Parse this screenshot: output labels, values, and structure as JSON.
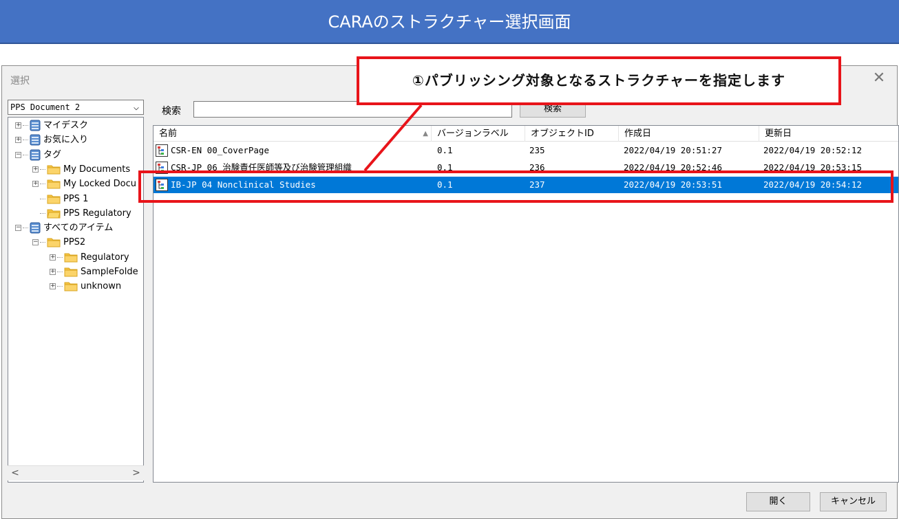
{
  "banner": {
    "title": "CARAのストラクチャー選択画面"
  },
  "dialog": {
    "title": "選択",
    "close_glyph": "✕",
    "repository": {
      "selected": "PPS Document 2",
      "arrow": "⌵"
    },
    "tree": {
      "nodes": [
        {
          "label": "マイデスク",
          "icon": "database-icon",
          "expander": "+"
        },
        {
          "label": "お気に入り",
          "icon": "database-icon",
          "expander": "+"
        },
        {
          "label": "タグ",
          "icon": "database-icon",
          "expander": "−"
        },
        {
          "label": "My Documents",
          "icon": "folder-icon",
          "expander": "+"
        },
        {
          "label": "My Locked Docu",
          "icon": "folder-icon",
          "expander": "+"
        },
        {
          "label": "PPS 1",
          "icon": "folder-icon",
          "expander": ""
        },
        {
          "label": "PPS Regulatory",
          "icon": "folder-open-icon",
          "expander": ""
        },
        {
          "label": "すべてのアイテム",
          "icon": "database-icon",
          "expander": "−"
        },
        {
          "label": "PPS2",
          "icon": "folder-icon",
          "expander": "−"
        },
        {
          "label": "Regulatory",
          "icon": "folder-icon",
          "expander": "+"
        },
        {
          "label": "SampleFolde",
          "icon": "folder-icon",
          "expander": "+"
        },
        {
          "label": "unknown",
          "icon": "folder-icon",
          "expander": "+"
        }
      ],
      "scroll_left": "<",
      "scroll_right": ">"
    },
    "search": {
      "label": "検索",
      "value": "",
      "button": "検索"
    },
    "table": {
      "columns": [
        "名前",
        "バージョンラベル",
        "オブジェクトID",
        "作成日",
        "更新日"
      ],
      "sort_glyph": "▲",
      "rows": [
        {
          "name": "CSR-EN 00_CoverPage",
          "version": "0.1",
          "object_id": "235",
          "created": "2022/04/19 20:51:27",
          "updated": "2022/04/19 20:52:12",
          "selected": false
        },
        {
          "name": "CSR-JP 06 治験責任医師等及び治験管理組織",
          "version": "0.1",
          "object_id": "236",
          "created": "2022/04/19 20:52:46",
          "updated": "2022/04/19 20:53:15",
          "selected": false
        },
        {
          "name": "IB-JP 04 Nonclinical Studies",
          "version": "0.1",
          "object_id": "237",
          "created": "2022/04/19 20:53:51",
          "updated": "2022/04/19 20:54:12",
          "selected": true
        }
      ]
    },
    "buttons": {
      "open": "開く",
      "cancel": "キャンセル"
    }
  },
  "annotation": {
    "callout": "①パブリッシング対象となるストラクチャーを指定します",
    "color": "#e8141a"
  },
  "colors": {
    "banner": "#4472c4",
    "selection": "#0078d7"
  }
}
